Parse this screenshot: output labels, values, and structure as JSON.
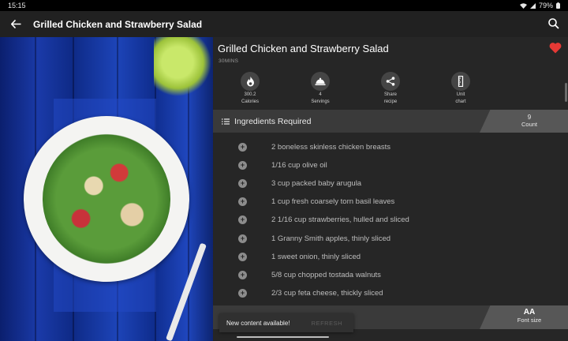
{
  "status_bar": {
    "time": "15:15",
    "battery": "79%"
  },
  "app_bar": {
    "title": "Grilled Chicken and Strawberry Salad"
  },
  "recipe": {
    "title": "Grilled Chicken and Strawberry Salad",
    "time": "30MINS",
    "stats": [
      {
        "value": "300.2",
        "label": "Calories",
        "icon": "flame-icon"
      },
      {
        "value": "4",
        "label": "Servings",
        "icon": "cloche-icon"
      },
      {
        "value": "Share",
        "label": "recipe",
        "icon": "share-icon"
      },
      {
        "value": "Unit",
        "label": "chart",
        "icon": "ruler-icon"
      }
    ]
  },
  "ingredients": {
    "title": "Ingredients Required",
    "count": "9",
    "count_label": "Count",
    "items": [
      "2 boneless skinless chicken breasts",
      "1/16 cup olive oil",
      "3 cup packed baby arugula",
      "1 cup fresh coarsely torn basil leaves",
      "2 1/16 cup strawberries, hulled and sliced",
      "1 Granny Smith apples, thinly sliced",
      "1 sweet onion, thinly sliced",
      "5/8 cup chopped tostada walnuts",
      "2/3 cup feta cheese, thickly sliced"
    ]
  },
  "font_size": {
    "label": "Font size",
    "icon_text": "AA"
  },
  "snackbar": {
    "message": "New content available!",
    "action": "REFRESH"
  },
  "colors": {
    "heart": "#e53935",
    "background": "#262626",
    "header": "#3a3a3a"
  }
}
